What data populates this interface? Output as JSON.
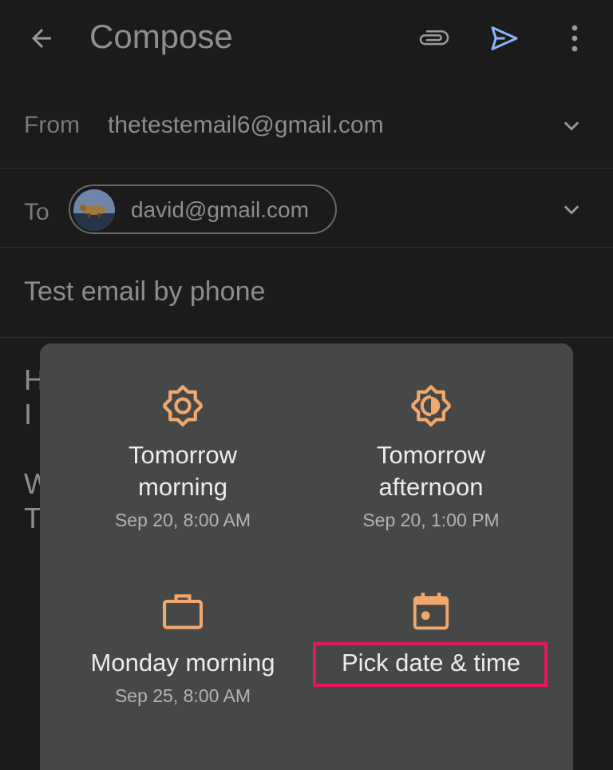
{
  "appbar": {
    "title": "Compose",
    "back_icon": "arrow-back-icon",
    "attach_icon": "paperclip-icon",
    "send_icon": "send-icon",
    "more_icon": "more-vert-icon"
  },
  "from": {
    "label": "From",
    "value": "thetestemail6@gmail.com"
  },
  "to": {
    "label": "To",
    "recipient": "david@gmail.com"
  },
  "subject": "Test email by phone",
  "body_partial": [
    "H",
    "I",
    "W",
    "T"
  ],
  "schedule": {
    "accent_color": "#f2a86d",
    "options": [
      {
        "label": "Tomorrow morning",
        "lines": [
          "Tomorrow",
          "morning"
        ],
        "sub": "Sep 20, 8:00 AM",
        "icon": "sun-icon"
      },
      {
        "label": "Tomorrow afternoon",
        "lines": [
          "Tomorrow",
          "afternoon"
        ],
        "sub": "Sep 20, 1:00 PM",
        "icon": "half-sun-icon"
      },
      {
        "label": "Monday morning",
        "lines": [
          "Monday morning"
        ],
        "sub": "Sep 25, 8:00 AM",
        "icon": "briefcase-icon"
      },
      {
        "label": "Pick date & time",
        "lines": [
          "Pick date & time"
        ],
        "sub": "",
        "icon": "calendar-icon"
      }
    ]
  },
  "highlight_color": "#e5195a"
}
